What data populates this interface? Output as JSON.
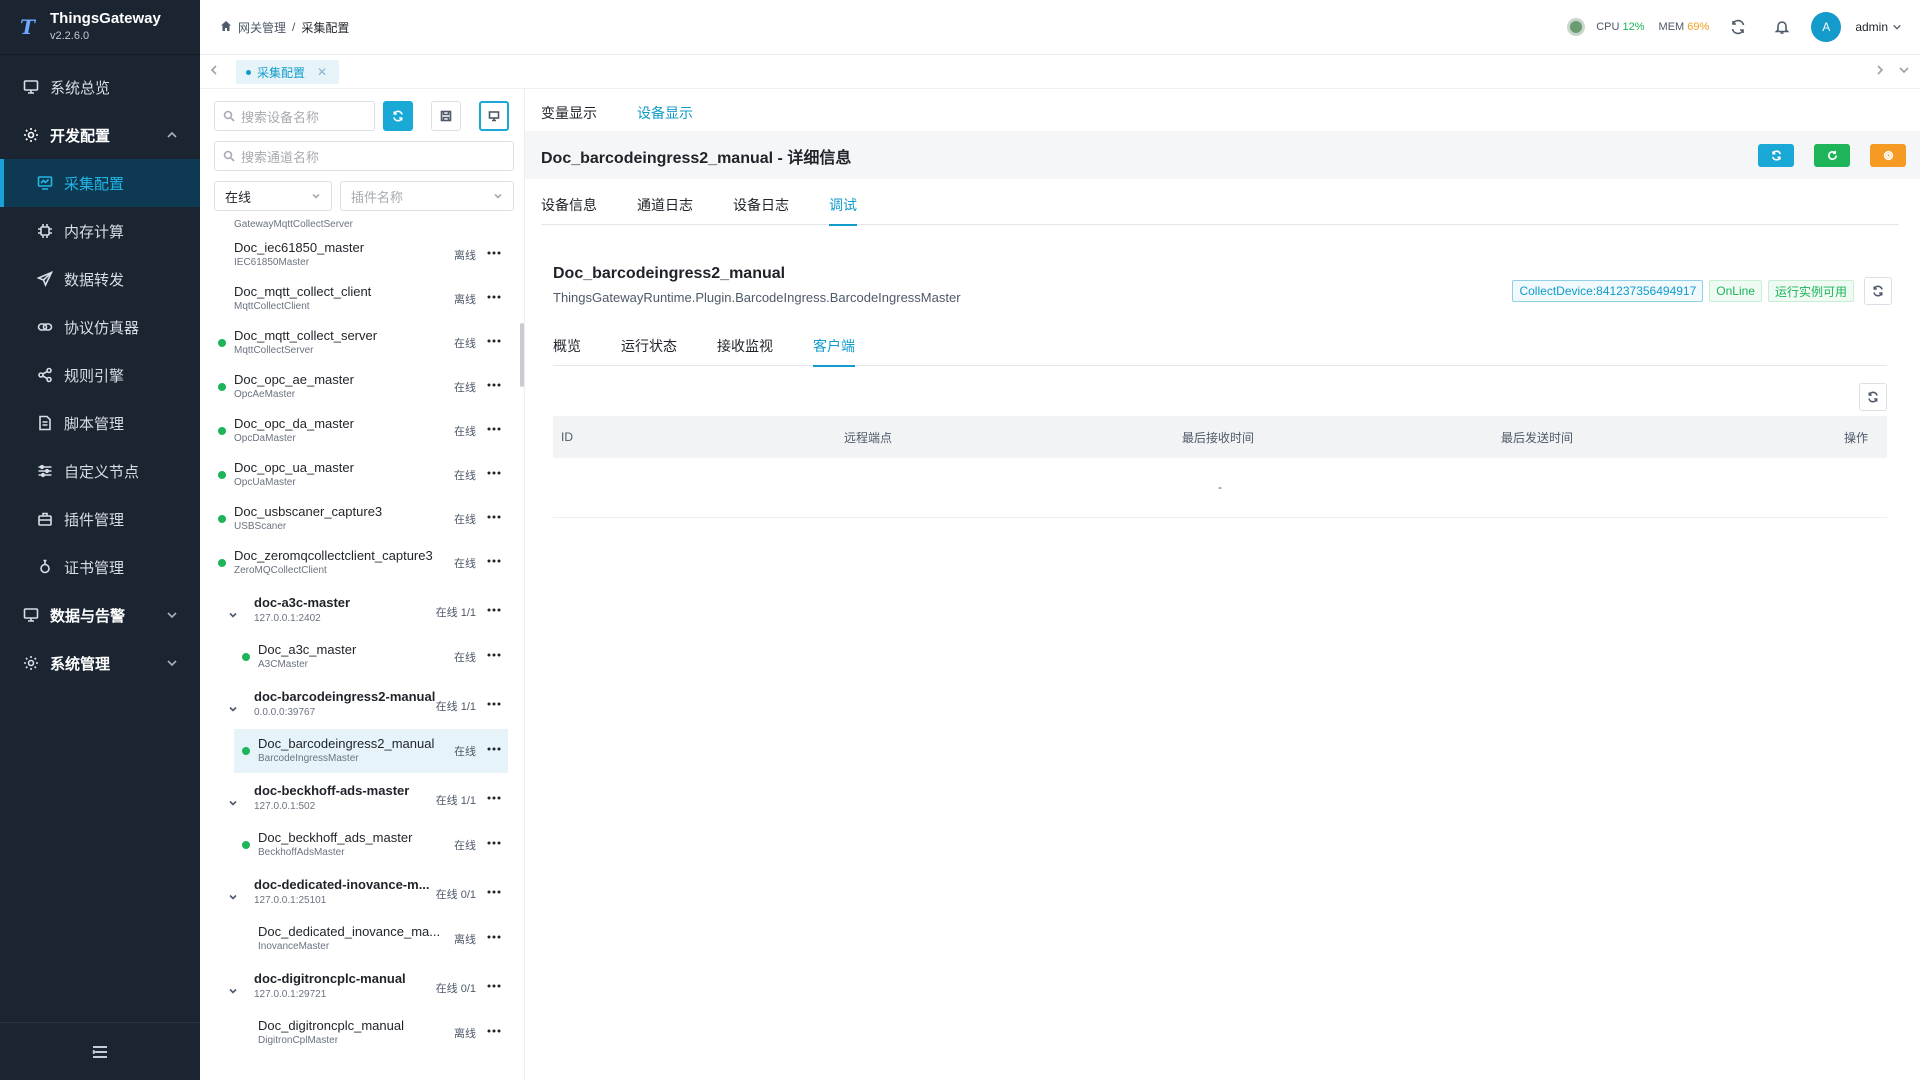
{
  "app": {
    "name": "ThingsGateway",
    "version": "v2.2.6.0"
  },
  "sidebar": {
    "items": [
      {
        "label": "系统总览",
        "icon": "monitor-icon"
      },
      {
        "label": "开发配置",
        "icon": "gear-icon"
      },
      {
        "label": "采集配置",
        "icon": "chart-monitor-icon"
      },
      {
        "label": "内存计算",
        "icon": "chip-icon"
      },
      {
        "label": "数据转发",
        "icon": "send-icon"
      },
      {
        "label": "协议仿真器",
        "icon": "link-icon"
      },
      {
        "label": "规则引擎",
        "icon": "share-icon"
      },
      {
        "label": "脚本管理",
        "icon": "file-icon"
      },
      {
        "label": "自定义节点",
        "icon": "sliders-icon"
      },
      {
        "label": "插件管理",
        "icon": "plugin-icon"
      },
      {
        "label": "证书管理",
        "icon": "certificate-icon"
      },
      {
        "label": "数据与告警",
        "icon": "monitor-icon"
      },
      {
        "label": "系统管理",
        "icon": "gear-icon"
      }
    ]
  },
  "header": {
    "breadcrumb": [
      "网关管理",
      "/",
      "采集配置"
    ],
    "cpu_label": "CPU",
    "cpu_value": "12%",
    "mem_label": "MEM",
    "mem_value": "69%",
    "avatar_letter": "A",
    "username": "admin"
  },
  "tabstrip": {
    "tab": "采集配置"
  },
  "left": {
    "search_device_placeholder": "搜索设备名称",
    "search_channel_placeholder": "搜索通道名称",
    "status_select": "在线",
    "plugin_placeholder": "插件名称",
    "nodes": [
      {
        "name": "",
        "sub": "GatewayMqttCollectServer",
        "status": "离线"
      },
      {
        "name": "Doc_iec61850_master",
        "sub": "IEC61850Master",
        "status": "离线"
      },
      {
        "name": "Doc_mqtt_collect_client",
        "sub": "MqttCollectClient",
        "status": "离线"
      },
      {
        "name": "Doc_mqtt_collect_server",
        "sub": "MqttCollectServer",
        "status": "在线"
      },
      {
        "name": "Doc_opc_ae_master",
        "sub": "OpcAeMaster",
        "status": "在线"
      },
      {
        "name": "Doc_opc_da_master",
        "sub": "OpcDaMaster",
        "status": "在线"
      },
      {
        "name": "Doc_opc_ua_master",
        "sub": "OpcUaMaster",
        "status": "在线"
      },
      {
        "name": "Doc_usbscaner_capture3",
        "sub": "USBScaner",
        "status": "在线"
      },
      {
        "name": "Doc_zeromqcollectclient_capture3",
        "sub": "ZeroMQCollectClient",
        "status": "在线"
      },
      {
        "name": "doc-a3c-master",
        "sub": "127.0.0.1:2402",
        "status": "在线 1/1"
      },
      {
        "name": "Doc_a3c_master",
        "sub": "A3CMaster",
        "status": "在线"
      },
      {
        "name": "doc-barcodeingress2-manual",
        "sub": "0.0.0.0:39767",
        "status": "在线 1/1"
      },
      {
        "name": "Doc_barcodeingress2_manual",
        "sub": "BarcodeIngressMaster",
        "status": "在线"
      },
      {
        "name": "doc-beckhoff-ads-master",
        "sub": "127.0.0.1:502",
        "status": "在线 1/1"
      },
      {
        "name": "Doc_beckhoff_ads_master",
        "sub": "BeckhoffAdsMaster",
        "status": "在线"
      },
      {
        "name": "doc-dedicated-inovance-m...",
        "sub": "127.0.0.1:25101",
        "status": "在线 0/1"
      },
      {
        "name": "Doc_dedicated_inovance_ma...",
        "sub": "InovanceMaster",
        "status": "离线"
      },
      {
        "name": "doc-digitroncplc-manual",
        "sub": "127.0.0.1:29721",
        "status": "在线 0/1"
      },
      {
        "name": "Doc_digitroncplc_manual",
        "sub": "DigitronCplMaster",
        "status": "离线"
      }
    ]
  },
  "main": {
    "top_tabs": [
      "变量显示",
      "设备显示"
    ],
    "title": "Doc_barcodeingress2_manual - 详细信息",
    "detail_tabs": [
      "设备信息",
      "通道日志",
      "设备日志",
      "调试"
    ],
    "device_name": "Doc_barcodeingress2_manual",
    "device_class": "ThingsGatewayRuntime.Plugin.BarcodeIngress.BarcodeIngressMaster",
    "badge_device": "CollectDevice:841237356494917",
    "badge_status": "OnLine",
    "badge_instance": "运行实例可用",
    "sub_tabs": [
      "概览",
      "运行状态",
      "接收监视",
      "客户端"
    ],
    "table": {
      "columns": [
        "ID",
        "远程端点",
        "最后接收时间",
        "最后发送时间",
        "操作"
      ],
      "empty": "-"
    }
  },
  "colors": {
    "accent": "#139bcb",
    "online": "#1db45a",
    "sidebar_bg": "#1b2431"
  }
}
